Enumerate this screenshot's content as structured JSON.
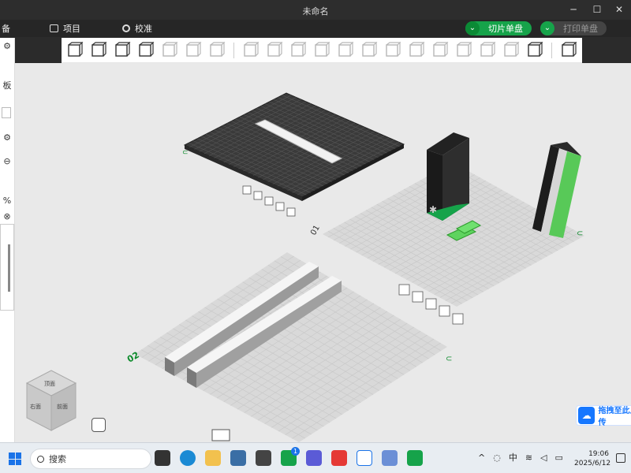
{
  "window": {
    "title": "未命名",
    "controls": [
      "minimize-icon",
      "maximize-icon",
      "close-icon"
    ]
  },
  "menubar": {
    "items": [
      {
        "label": "备"
      },
      {
        "label": "项目"
      },
      {
        "label": "校准"
      }
    ],
    "slice_button": "切片单盘",
    "print_button": "打印单盘"
  },
  "toolbar": {
    "icons": [
      "add-object-icon",
      "grid-arrange-icon",
      "auto-orient-icon",
      "layout-icon",
      "disk-d-icon",
      "disk-p-icon",
      "layers-icon",
      "move-icon",
      "rotate-icon",
      "scale-icon",
      "place-on-face-icon",
      "cut-icon",
      "split-icon",
      "support-icon",
      "hollow-icon",
      "text-icon",
      "paint-icon",
      "measure-icon",
      "assembly-icon",
      "fit-view-icon",
      "variable-layer-icon"
    ]
  },
  "leftpanel": {
    "labels": [
      "板"
    ]
  },
  "viewport": {
    "plate_labels": [
      "01",
      "02"
    ],
    "upload_label": "拖拽至此上传",
    "view_cube_faces": [
      "顶面",
      "右面",
      "前面"
    ]
  },
  "taskbar": {
    "search_placeholder": "搜索",
    "ime": "中",
    "time": "19:06",
    "date": "2025/6/12",
    "badge_count": "1"
  },
  "colors": {
    "accent": "#16a34a",
    "plate": "#d9d9d9",
    "dark_plate": "#3a3a3a",
    "upload_blue": "#1677ff"
  }
}
